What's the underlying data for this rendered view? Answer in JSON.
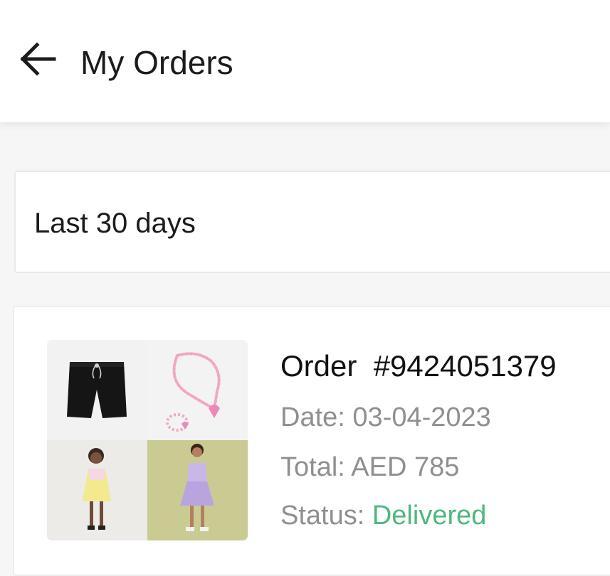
{
  "header": {
    "back_icon": "arrow-left-icon",
    "title": "My Orders"
  },
  "filter": {
    "selected": "Last 30 days"
  },
  "orders": [
    {
      "title": "Order",
      "number": "#9424051379",
      "date_label": "Date:",
      "date": "03-04-2023",
      "total_label": "Total:",
      "total": "AED 785",
      "status_label": "Status:",
      "status": "Delivered",
      "status_color": "#4db87d",
      "product_images": [
        "black-shorts",
        "pink-bead-necklace-set",
        "girl-yellow-dress",
        "girl-lilac-dress"
      ]
    }
  ],
  "colors": {
    "background": "#f6f6f6",
    "card": "#ffffff",
    "text_primary": "#1b1b1b",
    "text_secondary": "#8f8f8f",
    "accent_delivered": "#4db87d"
  }
}
